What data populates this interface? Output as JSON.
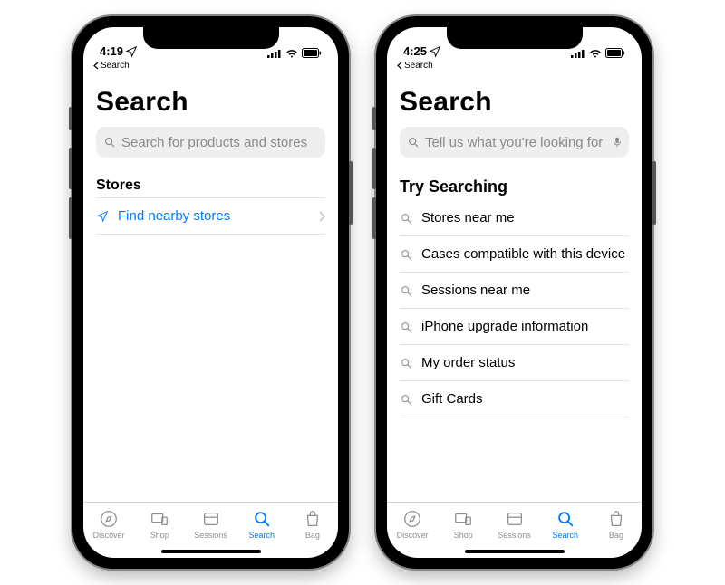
{
  "phones": {
    "left": {
      "status": {
        "time": "4:19",
        "back_label": "Search"
      },
      "title": "Search",
      "search_placeholder": "Search for products and stores",
      "section_title": "Stores",
      "find_nearby": "Find nearby stores"
    },
    "right": {
      "status": {
        "time": "4:25",
        "back_label": "Search"
      },
      "title": "Search",
      "search_placeholder": "Tell us what you're looking for",
      "section_title": "Try Searching",
      "suggestions": {
        "0": "Stores near me",
        "1": "Cases compatible with this device",
        "2": "Sessions near me",
        "3": "iPhone upgrade information",
        "4": "My order status",
        "5": "Gift Cards"
      }
    }
  },
  "tabs": {
    "discover": "Discover",
    "shop": "Shop",
    "sessions": "Sessions",
    "search": "Search",
    "bag": "Bag"
  }
}
